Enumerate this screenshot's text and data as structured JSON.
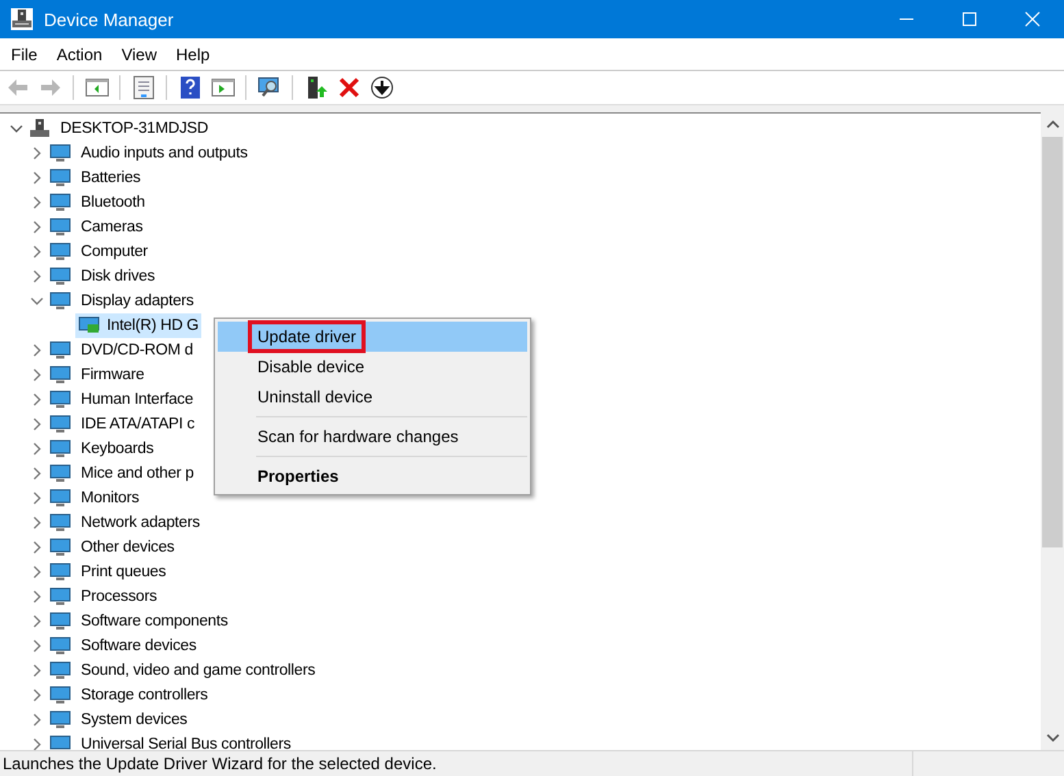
{
  "window": {
    "title": "Device Manager"
  },
  "menu": [
    "File",
    "Action",
    "View",
    "Help"
  ],
  "toolbar": [
    {
      "kind": "back",
      "disabled": true
    },
    {
      "kind": "forward",
      "disabled": true
    },
    {
      "kind": "sep"
    },
    {
      "kind": "panel"
    },
    {
      "kind": "sep"
    },
    {
      "kind": "properties"
    },
    {
      "kind": "sep"
    },
    {
      "kind": "help"
    },
    {
      "kind": "run"
    },
    {
      "kind": "sep"
    },
    {
      "kind": "scan"
    },
    {
      "kind": "sep"
    },
    {
      "kind": "update"
    },
    {
      "kind": "uninstall"
    },
    {
      "kind": "disable"
    }
  ],
  "tree": {
    "label": "DESKTOP-31MDJSD",
    "expanded": true,
    "children": [
      {
        "label": "Audio inputs and outputs",
        "expanded": false,
        "selected": false
      },
      {
        "label": "Batteries",
        "expanded": false,
        "selected": false
      },
      {
        "label": "Bluetooth",
        "expanded": false,
        "selected": false
      },
      {
        "label": "Cameras",
        "expanded": false,
        "selected": false
      },
      {
        "label": "Computer",
        "expanded": false,
        "selected": false
      },
      {
        "label": "Disk drives",
        "expanded": false,
        "selected": false
      },
      {
        "label": "Display adapters",
        "expanded": true,
        "selected": false,
        "children": [
          {
            "label": "Intel(R) HD G",
            "selected": true
          }
        ]
      },
      {
        "label": "DVD/CD-ROM d",
        "expanded": false,
        "selected": false
      },
      {
        "label": "Firmware",
        "expanded": false,
        "selected": false
      },
      {
        "label": "Human Interface",
        "expanded": false,
        "selected": false
      },
      {
        "label": "IDE ATA/ATAPI c",
        "expanded": false,
        "selected": false
      },
      {
        "label": "Keyboards",
        "expanded": false,
        "selected": false
      },
      {
        "label": "Mice and other p",
        "expanded": false,
        "selected": false
      },
      {
        "label": "Monitors",
        "expanded": false,
        "selected": false
      },
      {
        "label": "Network adapters",
        "expanded": false,
        "selected": false
      },
      {
        "label": "Other devices",
        "expanded": false,
        "selected": false
      },
      {
        "label": "Print queues",
        "expanded": false,
        "selected": false
      },
      {
        "label": "Processors",
        "expanded": false,
        "selected": false
      },
      {
        "label": "Software components",
        "expanded": false,
        "selected": false
      },
      {
        "label": "Software devices",
        "expanded": false,
        "selected": false
      },
      {
        "label": "Sound, video and game controllers",
        "expanded": false,
        "selected": false
      },
      {
        "label": "Storage controllers",
        "expanded": false,
        "selected": false
      },
      {
        "label": "System devices",
        "expanded": false,
        "selected": false
      },
      {
        "label": "Universal Serial Bus controllers",
        "expanded": false,
        "selected": false
      }
    ]
  },
  "context_menu": [
    {
      "kind": "item",
      "label": "Update driver",
      "selected": true,
      "outlined": true
    },
    {
      "kind": "item",
      "label": "Disable device",
      "selected": false,
      "outlined": false
    },
    {
      "kind": "item",
      "label": "Uninstall device",
      "selected": false,
      "outlined": false
    },
    {
      "kind": "separator"
    },
    {
      "kind": "item",
      "label": "Scan for hardware changes",
      "selected": false,
      "outlined": false
    },
    {
      "kind": "separator"
    },
    {
      "kind": "default",
      "label": "Properties",
      "selected": false,
      "outlined": false
    }
  ],
  "status_bar": "Launches the Update Driver Wizard for the selected device."
}
